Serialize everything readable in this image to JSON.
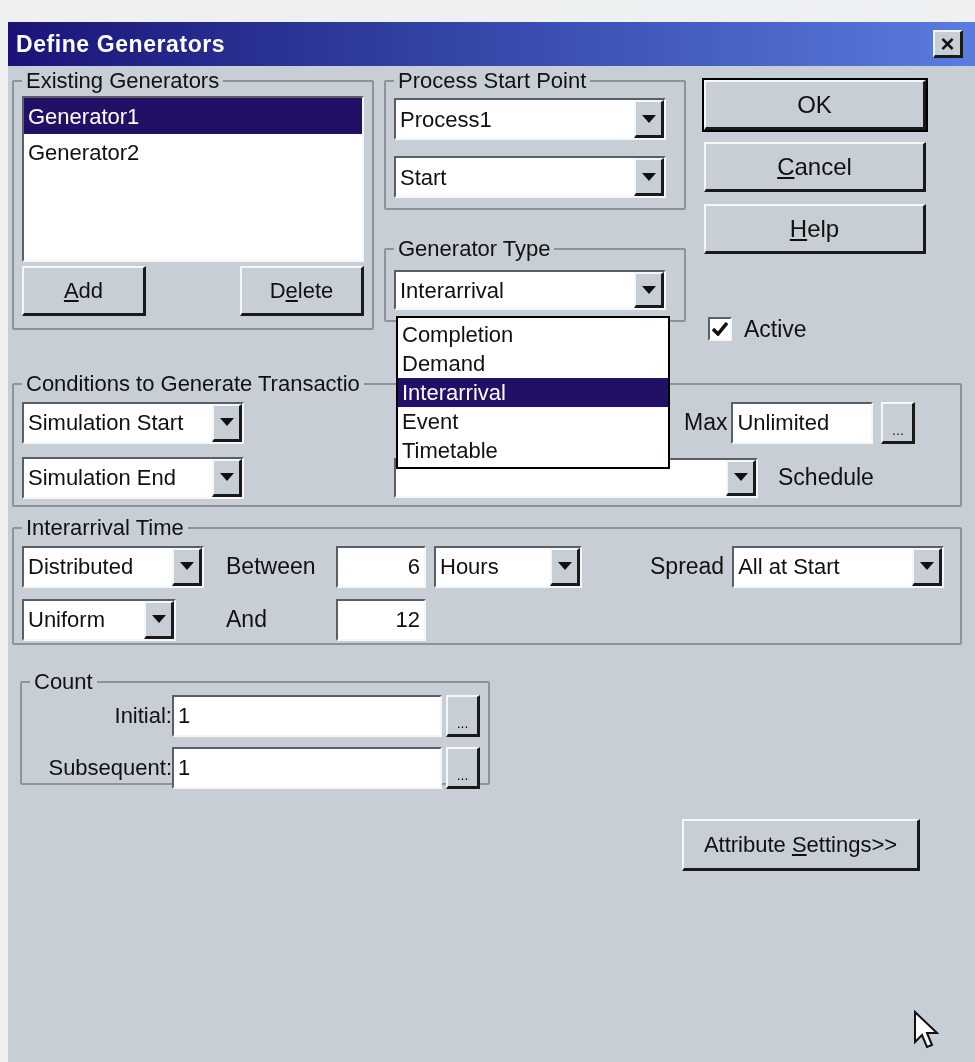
{
  "window": {
    "title": "Define Generators",
    "close": "×"
  },
  "existing_generators": {
    "label": "Existing Generators",
    "items": [
      {
        "text": "Generator1",
        "selected": true
      },
      {
        "text": "Generator2",
        "selected": false
      }
    ],
    "buttons": [
      {
        "key": "A",
        "after": "dd"
      },
      {
        "before": "D",
        "key": "e",
        "after": "lete"
      }
    ]
  },
  "process_start_point": {
    "label": "Process Start Point",
    "process": "Process1",
    "point": "Start"
  },
  "generator_type": {
    "label": "Generator Type",
    "value": "Interarrival",
    "expanded": true,
    "options": [
      {
        "text": "Completion",
        "selected": false
      },
      {
        "text": "Demand",
        "selected": false
      },
      {
        "text": "Interarrival",
        "selected": true
      },
      {
        "text": "Event",
        "selected": false
      },
      {
        "text": "Timetable",
        "selected": false
      }
    ]
  },
  "buttons": [
    {
      "before": "OK",
      "default": true
    },
    {
      "key": "C",
      "after": "ancel",
      "default": false
    },
    {
      "key": "H",
      "after": "elp",
      "default": false
    }
  ],
  "active": {
    "label": "Active",
    "checked": true
  },
  "conditions": {
    "label": "Conditions to Generate Transactio",
    "start": "Simulation Start",
    "end": "Simulation End",
    "max_label": "Max",
    "max_value": "Unlimited",
    "max_more": "...",
    "schedule_label": "Schedule"
  },
  "interarrival_time": {
    "label": "Interarrival Time",
    "mode": "Distributed",
    "distribution": "Uniform",
    "between_label": "Between",
    "between_value": "6",
    "unit": "Hours",
    "and_label": "And",
    "and_value": "12",
    "spread_label": "Spread",
    "spread": "All at Start"
  },
  "count": {
    "label": "Count",
    "rows": [
      {
        "label": "Initial:",
        "value": "1",
        "more": "..."
      },
      {
        "label": "Subsequent:",
        "value": "1",
        "more": "..."
      }
    ]
  },
  "attribute_button": {
    "before": "Attribute ",
    "key": "S",
    "after": "ettings>>"
  }
}
